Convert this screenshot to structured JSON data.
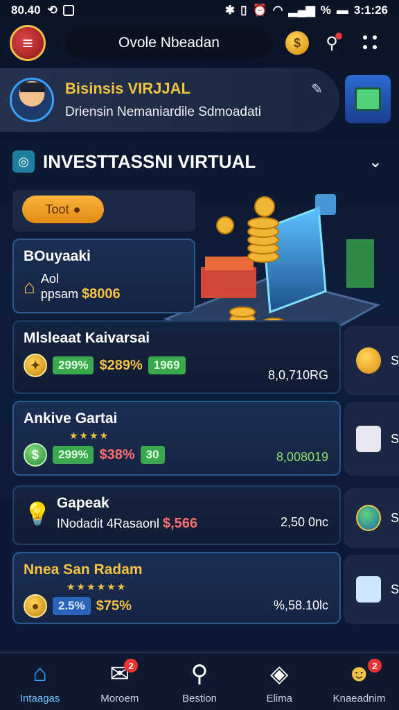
{
  "status_bar": {
    "time_left": "80.40",
    "time_right": "3:1:26",
    "signal_text": "%"
  },
  "header": {
    "title": "Ovole Nbeadan",
    "coin_symbol": "$"
  },
  "profile": {
    "title": "Bisinsis VIRJJAL",
    "subtitle": "Driensin Nemaniardile Sdmoadati"
  },
  "section": {
    "title": "INVESTTASSNI VIRTUAL"
  },
  "filter": {
    "label": "Toot"
  },
  "investments": [
    {
      "title": "BOuyaaki",
      "line_label": "Aol",
      "sub_label": "ppsam",
      "amount": "$8006"
    },
    {
      "title": "Mlsleaat Kaivarsai",
      "badge1": "299%",
      "value": "$289%",
      "badge2": "1969",
      "amount_right": "8,0,710RG"
    },
    {
      "title": "Ankive Gartai",
      "stars": "★★★★",
      "badge1": "299%",
      "value": "$38%",
      "badge2": "30",
      "amount_right": "8,008019"
    },
    {
      "title": "Gapeak",
      "sub_label": "INodadit 4Rasaonl",
      "value": "$,566",
      "amount_right": "2,50 0nc"
    },
    {
      "title": "Nnea San Radam",
      "stars": "★★★★★★",
      "badge1": "2.5%",
      "value": "$75%",
      "amount_right": "%,58.10lc"
    }
  ],
  "side_items": [
    "S",
    "S",
    "S",
    "S"
  ],
  "nav": [
    {
      "label": "Intaagas",
      "icon": "home-icon",
      "active": true
    },
    {
      "label": "Moroem",
      "icon": "chart-icon",
      "badge": "2"
    },
    {
      "label": "Bestion",
      "icon": "search-icon"
    },
    {
      "label": "Elima",
      "icon": "box-icon"
    },
    {
      "label": "Knaeadnim",
      "icon": "user-icon",
      "badge": "2"
    }
  ],
  "colors": {
    "accent": "#f5c242",
    "active": "#2ea8ff",
    "green": "#3aa94e"
  }
}
